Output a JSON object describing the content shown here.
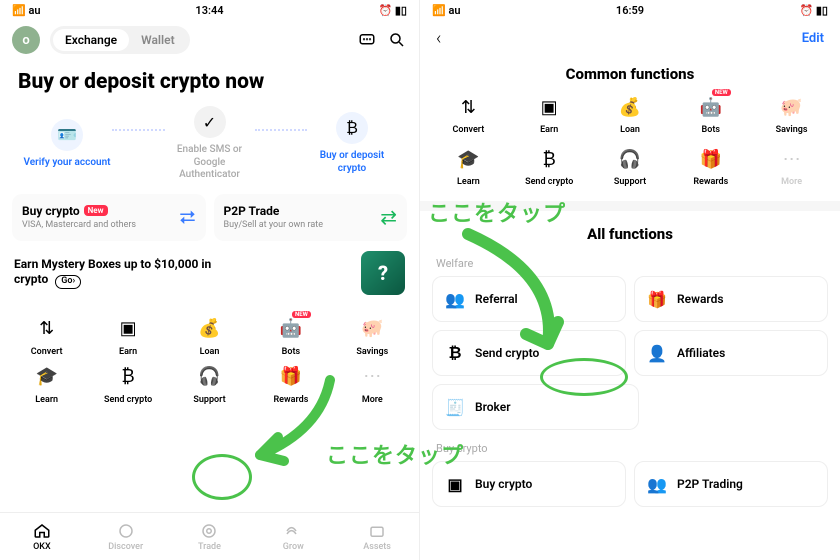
{
  "left": {
    "status": {
      "carrier": "au",
      "time": "13:44"
    },
    "avatar_letter": "o",
    "segment": {
      "exchange": "Exchange",
      "wallet": "Wallet"
    },
    "headline": "Buy or deposit crypto now",
    "steps": {
      "verify": "Verify your account",
      "sms": "Enable SMS or Google Authenticator",
      "deposit": "Buy or deposit crypto"
    },
    "buy_card": {
      "title": "Buy crypto",
      "badge": "New",
      "sub": "VISA, Mastercard and others"
    },
    "p2p_card": {
      "title": "P2P Trade",
      "sub": "Buy/Sell at your own rate"
    },
    "mystery": {
      "text": "Earn Mystery Boxes up to $10,000 in crypto",
      "go": "Go›"
    },
    "grid": {
      "convert": "Convert",
      "earn": "Earn",
      "loan": "Loan",
      "bots": "Bots",
      "savings": "Savings",
      "learn": "Learn",
      "send": "Send crypto",
      "support": "Support",
      "rewards": "Rewards",
      "more": "More"
    },
    "badges": {
      "new": "NEW"
    },
    "tabs": {
      "okx": "OKX",
      "discover": "Discover",
      "trade": "Trade",
      "grow": "Grow",
      "assets": "Assets"
    }
  },
  "right": {
    "status": {
      "carrier": "au",
      "time": "16:59"
    },
    "edit": "Edit",
    "common_title": "Common functions",
    "grid": {
      "convert": "Convert",
      "earn": "Earn",
      "loan": "Loan",
      "bots": "Bots",
      "savings": "Savings",
      "learn": "Learn",
      "send": "Send crypto",
      "support": "Support",
      "rewards": "Rewards",
      "more": "More"
    },
    "badges": {
      "new": "NEW"
    },
    "all_title": "All functions",
    "welfare_label": "Welfare",
    "tiles": {
      "referral": "Referral",
      "rewards": "Rewards",
      "send": "Send crypto",
      "affiliates": "Affiliates",
      "broker": "Broker"
    },
    "buycrypto_label": "Buy crypto",
    "tiles2": {
      "buy": "Buy crypto",
      "p2p": "P2P Trading"
    }
  },
  "annotations": {
    "tap_here": "ここをタップ"
  }
}
